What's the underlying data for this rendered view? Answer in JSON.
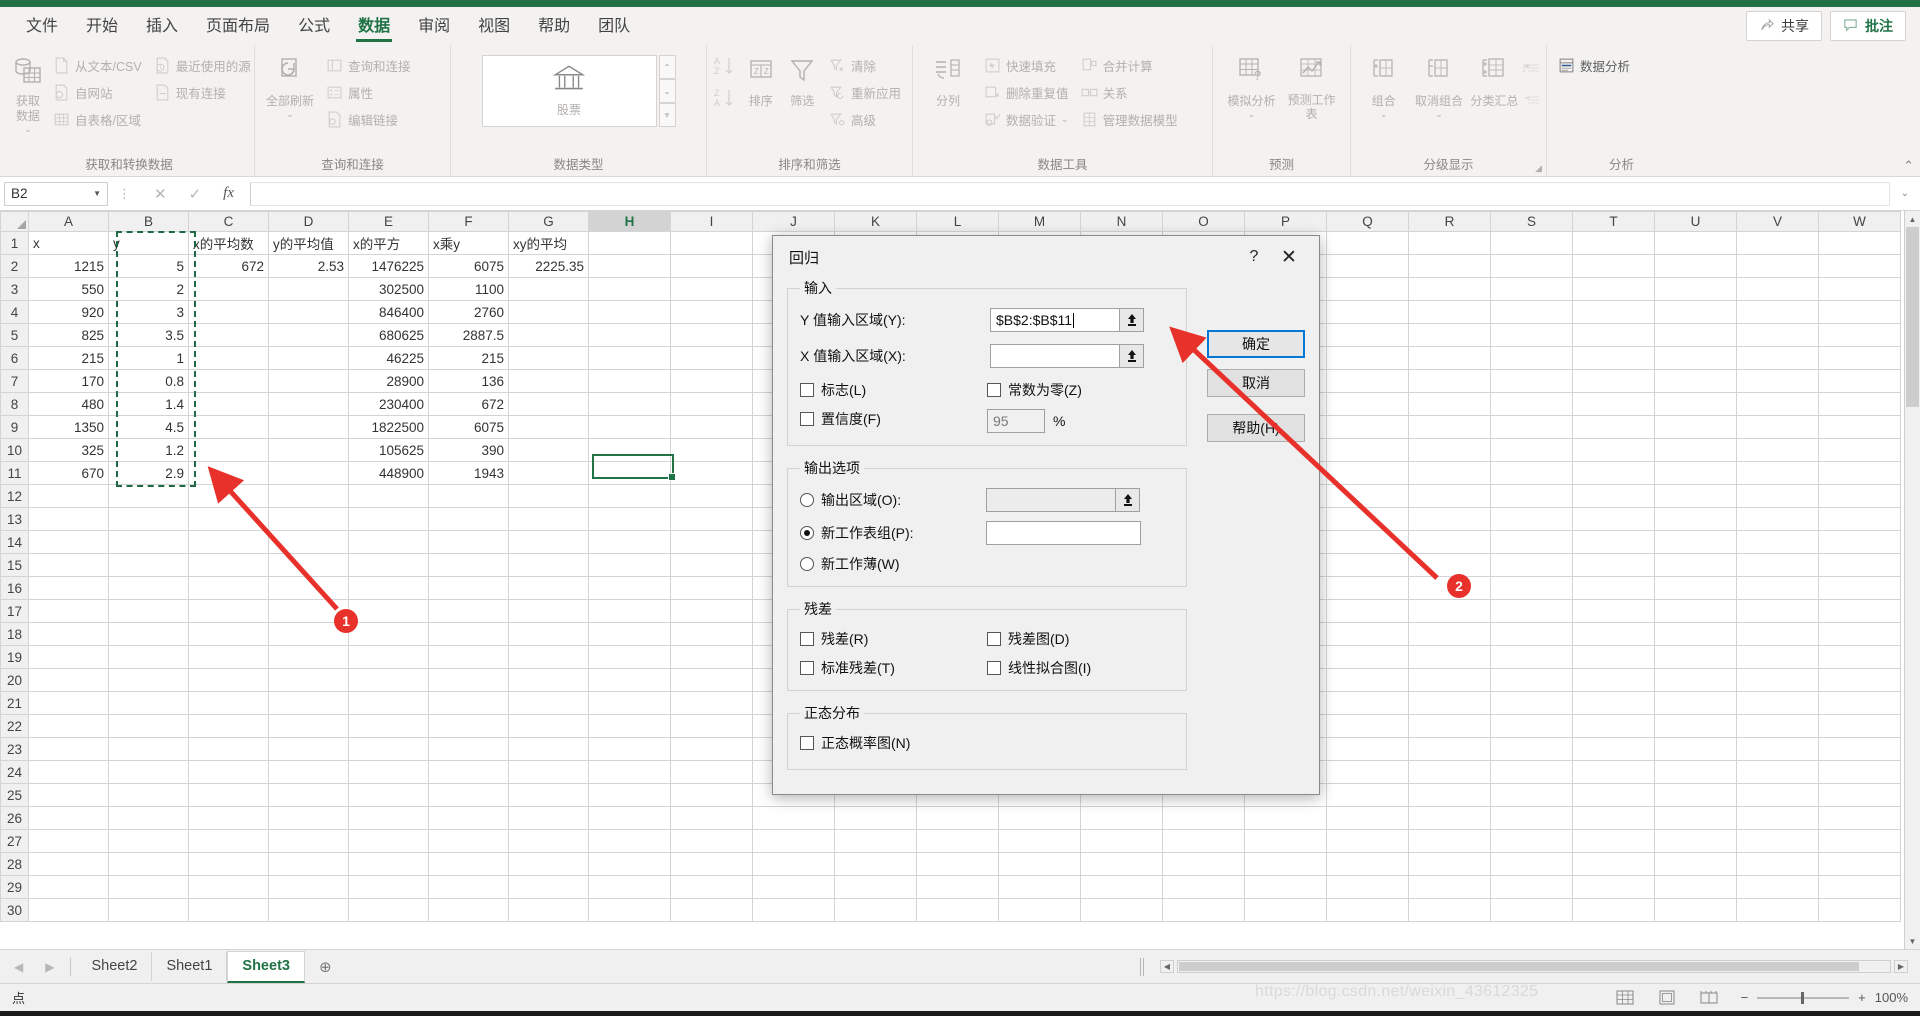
{
  "app": {
    "ribbon_tabs": [
      {
        "label": "文件",
        "active": false
      },
      {
        "label": "开始",
        "active": false
      },
      {
        "label": "插入",
        "active": false
      },
      {
        "label": "页面布局",
        "active": false
      },
      {
        "label": "公式",
        "active": false
      },
      {
        "label": "数据",
        "active": true
      },
      {
        "label": "审阅",
        "active": false
      },
      {
        "label": "视图",
        "active": false
      },
      {
        "label": "帮助",
        "active": false
      },
      {
        "label": "团队",
        "active": false
      }
    ],
    "share_label": "共享",
    "comment_label": "批注"
  },
  "ribbon": {
    "groups": [
      {
        "label": "获取和转换数据",
        "big": [
          {
            "label": "获取数据",
            "caret": "⌄"
          }
        ],
        "col1": [
          {
            "label": "从文本/CSV"
          },
          {
            "label": "自网站"
          },
          {
            "label": "自表格/区域"
          }
        ],
        "col2": [
          {
            "label": "最近使用的源"
          },
          {
            "label": "现有连接"
          }
        ]
      },
      {
        "label": "查询和连接",
        "big": [
          {
            "label": "全部刷新",
            "caret": "⌄"
          }
        ],
        "col1": [
          {
            "label": "查询和连接"
          },
          {
            "label": "属性"
          },
          {
            "label": "编辑链接"
          }
        ]
      },
      {
        "label": "数据类型",
        "stock_label": "股票"
      },
      {
        "label": "排序和筛选",
        "sort_label": "排序",
        "filter_label": "筛选",
        "col1": [
          {
            "label": "清除"
          },
          {
            "label": "重新应用"
          },
          {
            "label": "高级"
          }
        ]
      },
      {
        "label": "数据工具",
        "split_label": "分列",
        "col1": [
          {
            "label": "快速填充"
          },
          {
            "label": "删除重复值"
          },
          {
            "label": "数据验证",
            "caret": "⌄"
          }
        ],
        "col2": [
          {
            "label": "合并计算"
          },
          {
            "label": "关系"
          },
          {
            "label": "管理数据模型"
          }
        ]
      },
      {
        "label": "预测",
        "big": [
          {
            "label": "模拟分析",
            "caret": "⌄"
          },
          {
            "label": "预测工作表"
          }
        ]
      },
      {
        "label": "分级显示",
        "big": [
          {
            "label": "组合",
            "caret": "⌄"
          },
          {
            "label": "取消组合",
            "caret": "⌄"
          },
          {
            "label": "分类汇总"
          }
        ]
      },
      {
        "label": "分析",
        "col1": [
          {
            "label": "数据分析"
          }
        ]
      }
    ]
  },
  "formula_bar": {
    "name_box_value": "B2",
    "formula_value": "",
    "cancel_icon": "✕",
    "confirm_icon": "✓",
    "fx_icon": "fx"
  },
  "grid": {
    "columns": [
      "A",
      "B",
      "C",
      "D",
      "E",
      "F",
      "G",
      "H",
      "I",
      "J",
      "K",
      "L",
      "M",
      "N",
      "O",
      "P",
      "Q",
      "R",
      "S",
      "T",
      "U",
      "V",
      "W"
    ],
    "selected_column": "H",
    "row_count": 30,
    "headers": {
      "A": "x",
      "B": "y",
      "C": "x的平均数",
      "D": "y的平均值",
      "E": "x的平方",
      "F": "x乘y",
      "G": "xy的平均"
    },
    "rows": [
      {
        "r": 1,
        "A": "x",
        "B": "y",
        "C": "x的平均数",
        "D": "y的平均值",
        "E": "x的平方",
        "F": "x乘y",
        "G": "xy的平均",
        "align": "txt"
      },
      {
        "r": 2,
        "A": "1215",
        "B": "5",
        "C": "672",
        "D": "2.53",
        "E": "1476225",
        "F": "6075",
        "G": "2225.35"
      },
      {
        "r": 3,
        "A": "550",
        "B": "2",
        "C": "",
        "D": "",
        "E": "302500",
        "F": "1100",
        "G": ""
      },
      {
        "r": 4,
        "A": "920",
        "B": "3",
        "C": "",
        "D": "",
        "E": "846400",
        "F": "2760",
        "G": ""
      },
      {
        "r": 5,
        "A": "825",
        "B": "3.5",
        "C": "",
        "D": "",
        "E": "680625",
        "F": "2887.5",
        "G": ""
      },
      {
        "r": 6,
        "A": "215",
        "B": "1",
        "C": "",
        "D": "",
        "E": "46225",
        "F": "215",
        "G": ""
      },
      {
        "r": 7,
        "A": "170",
        "B": "0.8",
        "C": "",
        "D": "",
        "E": "28900",
        "F": "136",
        "G": ""
      },
      {
        "r": 8,
        "A": "480",
        "B": "1.4",
        "C": "",
        "D": "",
        "E": "230400",
        "F": "672",
        "G": ""
      },
      {
        "r": 9,
        "A": "1350",
        "B": "4.5",
        "C": "",
        "D": "",
        "E": "1822500",
        "F": "6075",
        "G": ""
      },
      {
        "r": 10,
        "A": "325",
        "B": "1.2",
        "C": "",
        "D": "",
        "E": "105625",
        "F": "390",
        "G": ""
      },
      {
        "r": 11,
        "A": "670",
        "B": "2.9",
        "C": "",
        "D": "",
        "E": "448900",
        "F": "1943",
        "G": ""
      }
    ]
  },
  "dialog": {
    "title": "回归",
    "help_icon": "?",
    "close_icon": "✕",
    "input_group_label": "输入",
    "y_range_label": "Y 值输入区域(Y):",
    "y_range_value": "$B$2:$B$11",
    "x_range_label": "X 值输入区域(X):",
    "x_range_value": "",
    "labels_checkbox": "标志(L)",
    "constant_zero_checkbox": "常数为零(Z)",
    "confidence_checkbox": "置信度(F)",
    "confidence_value": "95",
    "percent_sign": "%",
    "output_group_label": "输出选项",
    "output_range_radio": "输出区域(O):",
    "output_range_value": "",
    "new_worksheet_radio": "新工作表组(P):",
    "new_worksheet_value": "",
    "new_workbook_radio": "新工作薄(W)",
    "selected_output": "new_worksheet",
    "residual_group_label": "残差",
    "residual_checkbox": "残差(R)",
    "residual_plot_checkbox": "残差图(D)",
    "std_residual_checkbox": "标准残差(T)",
    "line_fit_plot_checkbox": "线性拟合图(I)",
    "normal_group_label": "正态分布",
    "normal_prob_checkbox": "正态概率图(N)",
    "ok_button": "确定",
    "cancel_button": "取消",
    "help_button": "帮助(H)"
  },
  "annotations": {
    "accent_color": "#e8312a",
    "markers": [
      {
        "id": "1",
        "label": "1"
      },
      {
        "id": "2",
        "label": "2"
      }
    ]
  },
  "sheet_tabs": {
    "prev_icon": "◀",
    "next_icon": "▶",
    "tabs": [
      {
        "label": "Sheet2",
        "active": false
      },
      {
        "label": "Sheet1",
        "active": false
      },
      {
        "label": "Sheet3",
        "active": true
      }
    ],
    "add_icon": "⊕"
  },
  "status_bar": {
    "mode": "点",
    "zoom_level": "100%",
    "watermark": "https://blog.csdn.net/weixin_43612325",
    "minus": "−",
    "plus": "+"
  }
}
